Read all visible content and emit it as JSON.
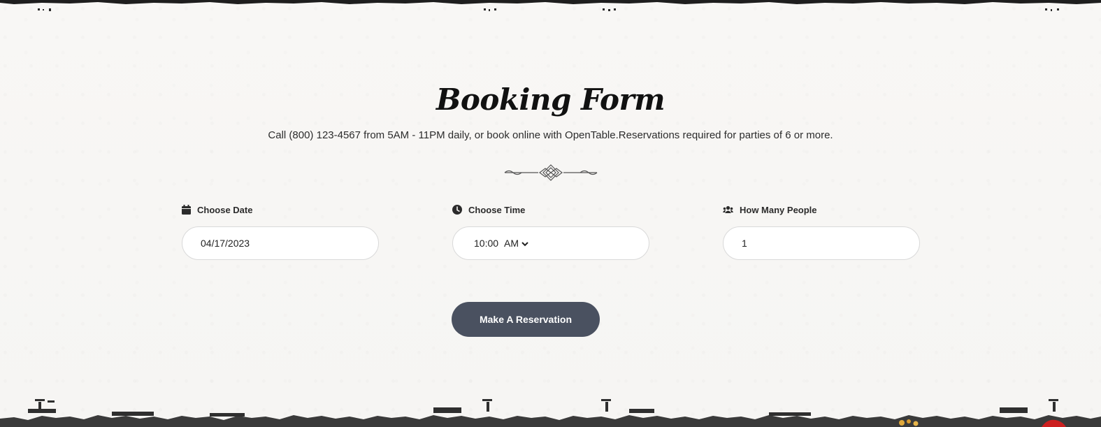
{
  "header": {
    "title": "Booking Form",
    "subtitle": "Call (800) 123-4567 from 5AM - 11PM daily, or book online with OpenTable.Reservations required for parties of 6 or more."
  },
  "form": {
    "date": {
      "label": "Choose Date",
      "icon": "calendar-icon",
      "value": "04/17/2023"
    },
    "time": {
      "label": "Choose Time",
      "icon": "clock-icon",
      "value": "10:00",
      "meridiem": "AM"
    },
    "people": {
      "label": "How Many People",
      "icon": "users-icon",
      "value": "1"
    },
    "submit_label": "Make A Reservation"
  },
  "colors": {
    "button_bg": "#4a5160",
    "page_bg": "#f7f6f4",
    "title": "#111111"
  }
}
